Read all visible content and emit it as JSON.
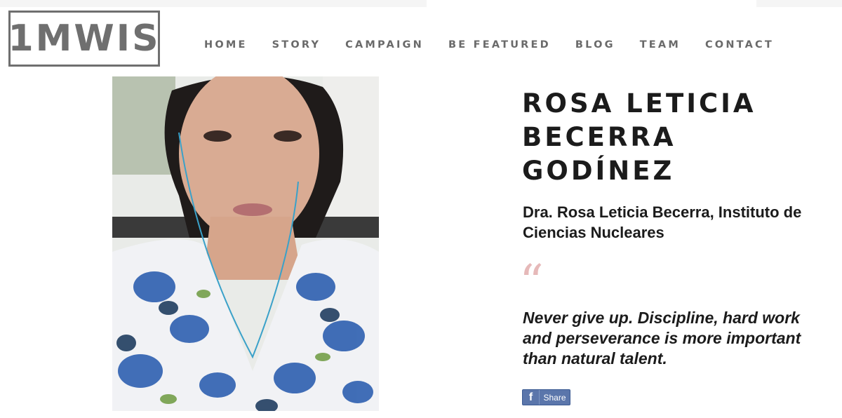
{
  "site": {
    "logo_text": "1MWIS"
  },
  "nav": {
    "items": [
      {
        "label": "HOME"
      },
      {
        "label": "STORY"
      },
      {
        "label": "CAMPAIGN"
      },
      {
        "label": "BE FEATURED"
      },
      {
        "label": "BLOG"
      },
      {
        "label": "TEAM"
      },
      {
        "label": "CONTACT"
      }
    ]
  },
  "profile": {
    "name_lines": [
      "ROSA LETICIA",
      "BECERRA",
      "GODÍNEZ"
    ],
    "affiliation": "Dra. Rosa Leticia Becerra, Instituto de Ciencias Nucleares",
    "quote_mark": "“",
    "quote": "Never give up. Discipline, hard work and perseverance is more important than natural talent."
  },
  "share": {
    "icon_glyph": "f",
    "label": "Share",
    "icon": "facebook-icon"
  }
}
